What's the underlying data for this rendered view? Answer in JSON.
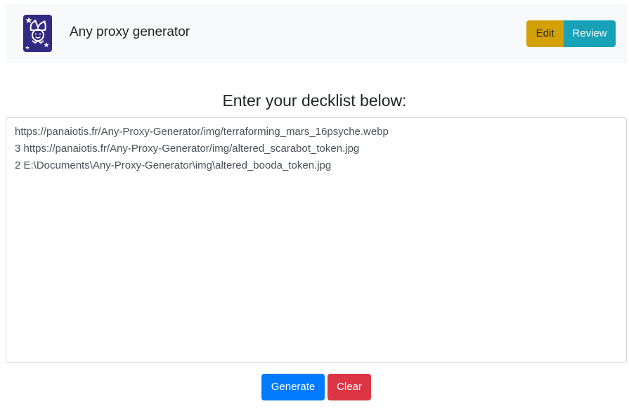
{
  "header": {
    "logo_icon": "jester-card-icon",
    "title": "Any proxy generator",
    "modes": {
      "edit_label": "Edit",
      "review_label": "Review"
    }
  },
  "main": {
    "heading": "Enter your decklist below:",
    "decklist_value": "https://panaiotis.fr/Any-Proxy-Generator/img/terraforming_mars_16psyche.webp\n3 https://panaiotis.fr/Any-Proxy-Generator/img/altered_scarabot_token.jpg\n2 E:\\Documents\\Any-Proxy-Generator\\img\\altered_booda_token.jpg"
  },
  "actions": {
    "generate_label": "Generate",
    "clear_label": "Clear"
  },
  "colors": {
    "navbar_bg": "#f8f9fa",
    "logo_bg": "#332a84",
    "edit": "#d4a008",
    "review": "#17a2b8",
    "generate": "#007bff",
    "clear": "#dc3545"
  }
}
